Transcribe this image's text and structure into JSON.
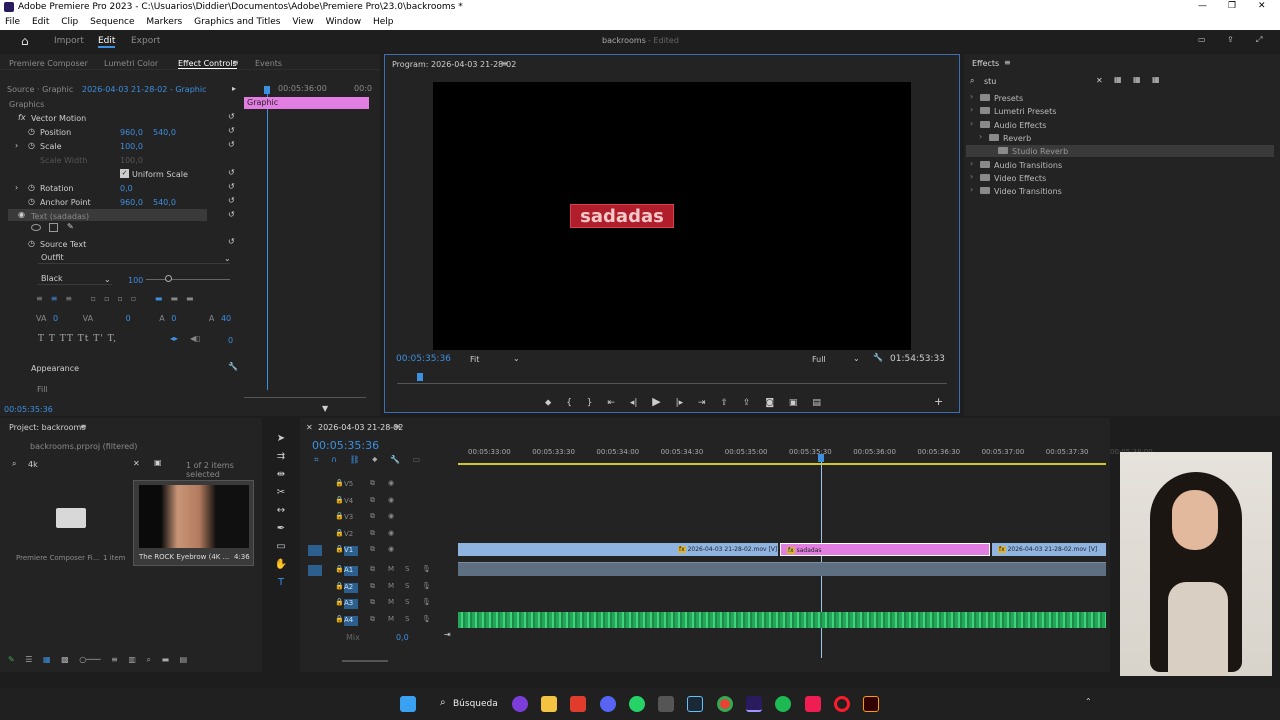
{
  "window": {
    "title": "Adobe Premiere Pro 2023 - C:\\Usuarios\\Diddier\\Documentos\\Adobe\\Premiere Pro\\23.0\\backrooms *"
  },
  "menu": [
    "File",
    "Edit",
    "Clip",
    "Sequence",
    "Markers",
    "Graphics and Titles",
    "View",
    "Window",
    "Help"
  ],
  "workspace": {
    "tabs": [
      "Import",
      "Edit",
      "Export"
    ],
    "project": "backrooms",
    "status": "- Edited"
  },
  "effect_controls": {
    "tabs": [
      "Premiere Composer",
      "Lumetri Color",
      "Effect Controls",
      "Events"
    ],
    "source": "Source · Graphic",
    "clip": "2026-04-03 21-28-02 - Graphic",
    "timecode_mini": "00:05:36:00",
    "timecode_end": "00:0",
    "section": "Graphics",
    "clip_bar": "Graphic",
    "vector_motion": "Vector Motion",
    "position_label": "Position",
    "pos_x": "960,0",
    "pos_y": "540,0",
    "scale_label": "Scale",
    "scale": "100,0",
    "scale_width": "Scale Width",
    "scale_width_val": "100,0",
    "uniform": "Uniform Scale",
    "rotation_label": "Rotation",
    "rotation": "0,0",
    "anchor_label": "Anchor Point",
    "anc_x": "960,0",
    "anc_y": "540,0",
    "text_layer": "Text (sadadas)",
    "source_text": "Source Text",
    "font": "Outfit",
    "weight": "Black",
    "size": "100",
    "appearance": "Appearance",
    "fill": "Fill",
    "time": "00:05:35:36",
    "num0a": "0",
    "num0b": "0",
    "num0c": "0",
    "num40": "40",
    "num0d": "0",
    "text_styles": "T T TT Tt T' T,"
  },
  "program": {
    "title": "Program: 2026-04-03 21-28-02",
    "overlay_text": "sadadas",
    "timecode": "00:05:35:36",
    "fit": "Fit",
    "quality": "Full",
    "duration": "01:54:53:33"
  },
  "effects": {
    "title": "Effects",
    "search": "stu",
    "items": [
      {
        "label": "Presets",
        "indent": 0
      },
      {
        "label": "Lumetri Presets",
        "indent": 0
      },
      {
        "label": "Audio Effects",
        "indent": 0
      },
      {
        "label": "Reverb",
        "indent": 1
      },
      {
        "label": "Studio Reverb",
        "indent": 2,
        "selected": true
      },
      {
        "label": "Audio Transitions",
        "indent": 0
      },
      {
        "label": "Video Effects",
        "indent": 0
      },
      {
        "label": "Video Transitions",
        "indent": 0
      }
    ]
  },
  "project": {
    "title": "Project: backrooms",
    "file": "backrooms.prproj (filtered)",
    "search": "4k",
    "count": "1 of 2 items selected",
    "folder_name": "Premiere Composer Fi...",
    "folder_items": "1 item",
    "clip_name": "The ROCK Eyebrow (4K ...",
    "clip_dur": "4:36"
  },
  "timeline": {
    "sequence": "2026-04-03 21-28-02",
    "timecode": "00:05:35:36",
    "ruler": [
      "00:05:33:00",
      "00:05:33:30",
      "00:05:34:00",
      "00:05:34:30",
      "00:05:35:00",
      "00:05:35:30",
      "00:05:36:00",
      "00:05:36:30",
      "00:05:37:00",
      "00:05:37:30",
      "00:05:38:00"
    ],
    "tracks_v": [
      "V5",
      "V4",
      "V3",
      "V2",
      "V1"
    ],
    "tracks_a": [
      "A1",
      "A2",
      "A3",
      "A4"
    ],
    "mix": "Mix",
    "mix_val": "0,0",
    "clip1": "2026-04-03 21-28-02.mov [V]",
    "clip2": "sadadas",
    "clip3": "2026-04-03 21-28-02.mov [V]"
  },
  "taskbar": {
    "search": "Búsqueda"
  },
  "colors": {
    "accent": "#3d8fe0",
    "graphic": "#e27ee2",
    "video": "#8fb4df",
    "audio": "#26a65b"
  }
}
